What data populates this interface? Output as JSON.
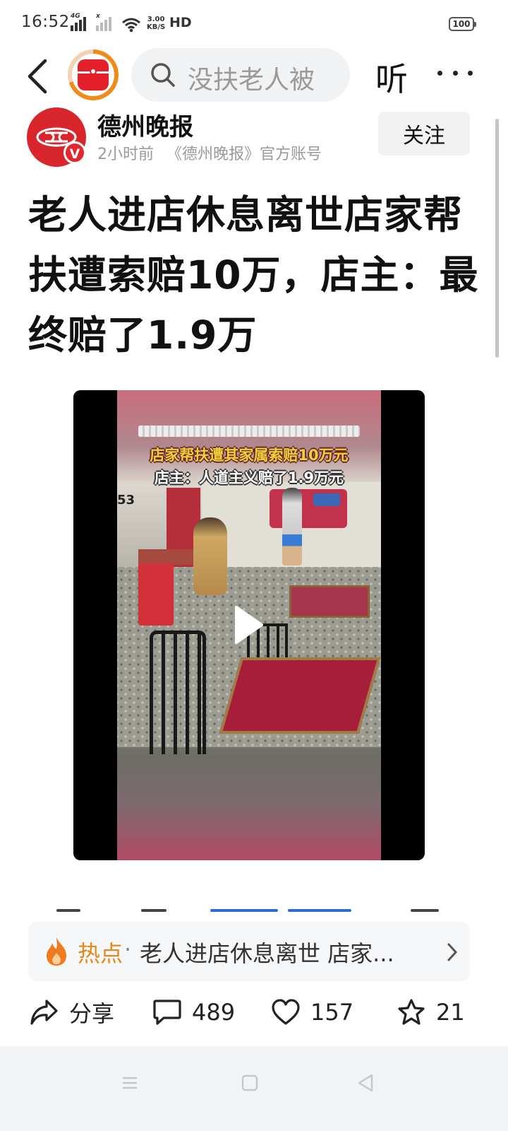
{
  "status_bar": {
    "time": "16:52",
    "sim1_label": "4G",
    "sim2_label": "x",
    "net_speed_value": "3.00",
    "net_speed_unit": "KB/S",
    "network_type": "HD",
    "battery": "100"
  },
  "top_nav": {
    "search_placeholder": "没扶老人被",
    "listen_label": "听",
    "icons": [
      "back-icon",
      "app-logo-icon",
      "search-icon",
      "more-icon"
    ]
  },
  "author": {
    "name": "德州晚报",
    "time": "2小时前",
    "account_desc": "《德州晚报》官方账号",
    "verified_mark": "V",
    "follow_label": "关注"
  },
  "article": {
    "title": "老人进店休息离世店家帮扶遭索赔10万，店主：最终赔了1.9万"
  },
  "video": {
    "caption_line1": "店家帮扶遭其家属索赔10万元",
    "caption_line2": "店主：人道主义赔了1.9万元",
    "camera_label": "53"
  },
  "hot_topic": {
    "label": "热点",
    "separator": "·",
    "text": "老人进店休息离世 店家..."
  },
  "actions": {
    "share_label": "分享",
    "comments": "489",
    "likes": "157",
    "favorites": "21"
  },
  "colors": {
    "accent_orange": "#e4881b",
    "brand_red": "#e4212a",
    "caption_yellow": "#f1cf3a"
  }
}
